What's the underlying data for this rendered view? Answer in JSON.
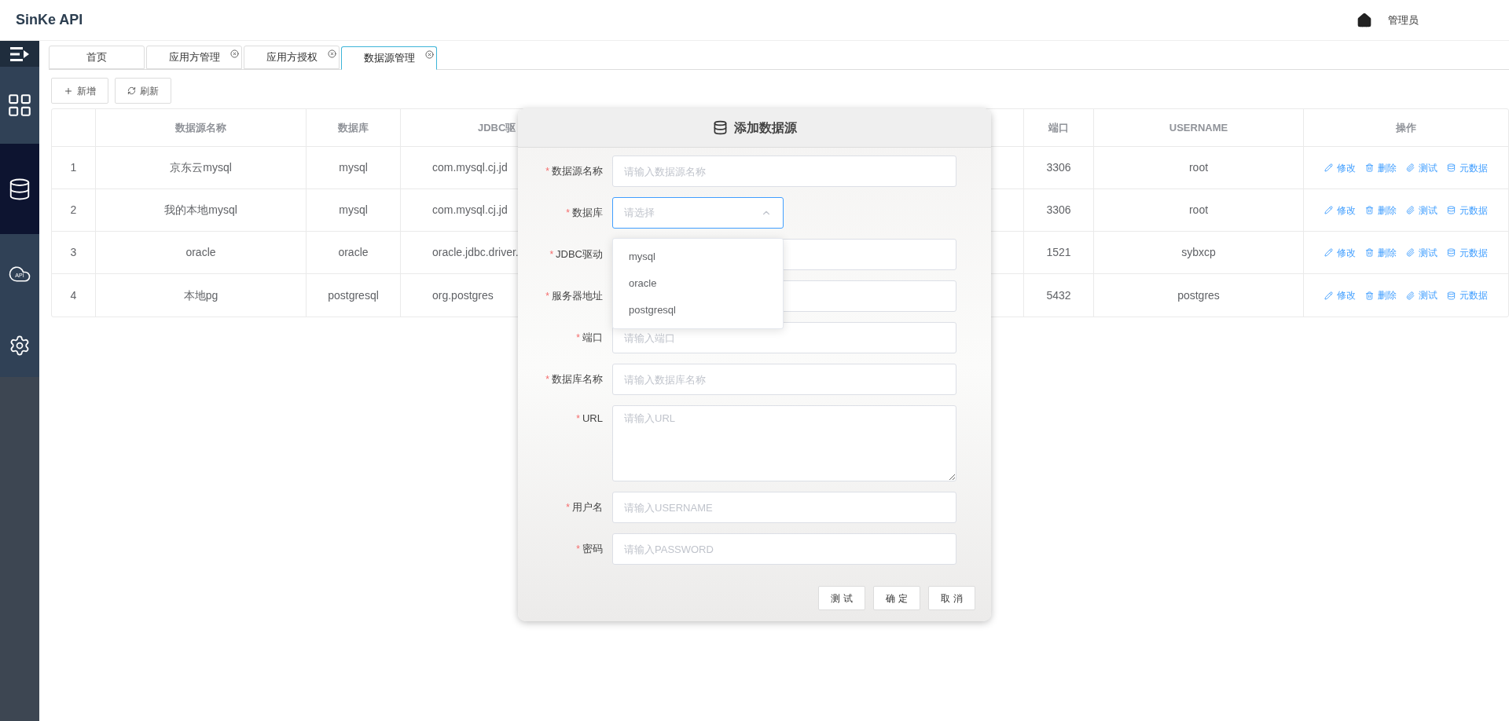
{
  "header": {
    "title": "SinKe API",
    "user": "管理员"
  },
  "sidebar": {
    "items": [
      {
        "kind": "dashboard",
        "selected": false
      },
      {
        "kind": "database",
        "selected": true
      },
      {
        "kind": "api",
        "label": "API",
        "selected": false
      },
      {
        "kind": "settings",
        "selected": false
      }
    ]
  },
  "tabs": [
    {
      "label": "首页",
      "closable": false,
      "selected": false
    },
    {
      "label": "应用方管理",
      "closable": true,
      "selected": false
    },
    {
      "label": "应用方授权",
      "closable": true,
      "selected": false
    },
    {
      "label": "数据源管理",
      "closable": true,
      "selected": true
    }
  ],
  "toolbar": [
    {
      "kind": "add",
      "label": "新增"
    },
    {
      "kind": "refresh",
      "label": "刷新"
    }
  ],
  "table": {
    "columns": [
      "",
      "数据源名称",
      "数据库",
      "JDBC驱",
      "端口",
      "USERNAME",
      "操作"
    ],
    "rows": [
      {
        "cells": [
          "1",
          "京东云mysql",
          "mysql",
          "com.mysql.cj.jd",
          "3306",
          "root"
        ],
        "actions": [
          {
            "kind": "edit",
            "label": "修改"
          },
          {
            "kind": "delete",
            "label": "删除"
          },
          {
            "kind": "test",
            "label": "测试"
          },
          {
            "kind": "meta",
            "label": "元数据"
          }
        ]
      },
      {
        "cells": [
          "2",
          "我的本地mysql",
          "mysql",
          "com.mysql.cj.jd",
          "3306",
          "root"
        ],
        "actions": [
          {
            "kind": "edit",
            "label": "修改"
          },
          {
            "kind": "delete",
            "label": "删除"
          },
          {
            "kind": "test",
            "label": "测试"
          },
          {
            "kind": "meta",
            "label": "元数据"
          }
        ]
      },
      {
        "cells": [
          "3",
          "oracle",
          "oracle",
          "oracle.jdbc.driver.",
          "1521",
          "sybxcp"
        ],
        "actions": [
          {
            "kind": "edit",
            "label": "修改"
          },
          {
            "kind": "delete",
            "label": "删除"
          },
          {
            "kind": "test",
            "label": "测试"
          },
          {
            "kind": "meta",
            "label": "元数据"
          }
        ]
      },
      {
        "cells": [
          "4",
          "本地pg",
          "postgresql",
          "org.postgres",
          "5432",
          "postgres"
        ],
        "actions": [
          {
            "kind": "edit",
            "label": "修改"
          },
          {
            "kind": "delete",
            "label": "删除"
          },
          {
            "kind": "test",
            "label": "测试"
          },
          {
            "kind": "meta",
            "label": "元数据"
          }
        ]
      }
    ]
  },
  "modal": {
    "title": "添加数据源",
    "fields": [
      {
        "kind": "input",
        "required_mark": "*",
        "label": "数据源名称",
        "placeholder": "请输入数据源名称"
      },
      {
        "kind": "select",
        "required_mark": "*",
        "label": "数据库",
        "placeholder": "请选择",
        "open": true,
        "options": [
          "mysql",
          "oracle",
          "postgresql"
        ]
      },
      {
        "kind": "input",
        "required_mark": "*",
        "label": "JDBC驱动"
      },
      {
        "kind": "input",
        "required_mark": "*",
        "label": "服务器地址"
      },
      {
        "kind": "input",
        "required_mark": "*",
        "label": "端口",
        "placeholder": "请输入端口"
      },
      {
        "kind": "input",
        "required_mark": "*",
        "label": "数据库名称",
        "placeholder": "请输入数据库名称"
      },
      {
        "kind": "textarea",
        "required_mark": "*",
        "label": "URL",
        "placeholder": "请输入URL"
      },
      {
        "kind": "input",
        "required_mark": "*",
        "label": "用户名",
        "placeholder": "请输入USERNAME"
      },
      {
        "kind": "input",
        "required_mark": "*",
        "label": "密码",
        "placeholder": "请输入PASSWORD"
      }
    ],
    "buttons": [
      "测 试",
      "确 定",
      "取 消"
    ]
  }
}
